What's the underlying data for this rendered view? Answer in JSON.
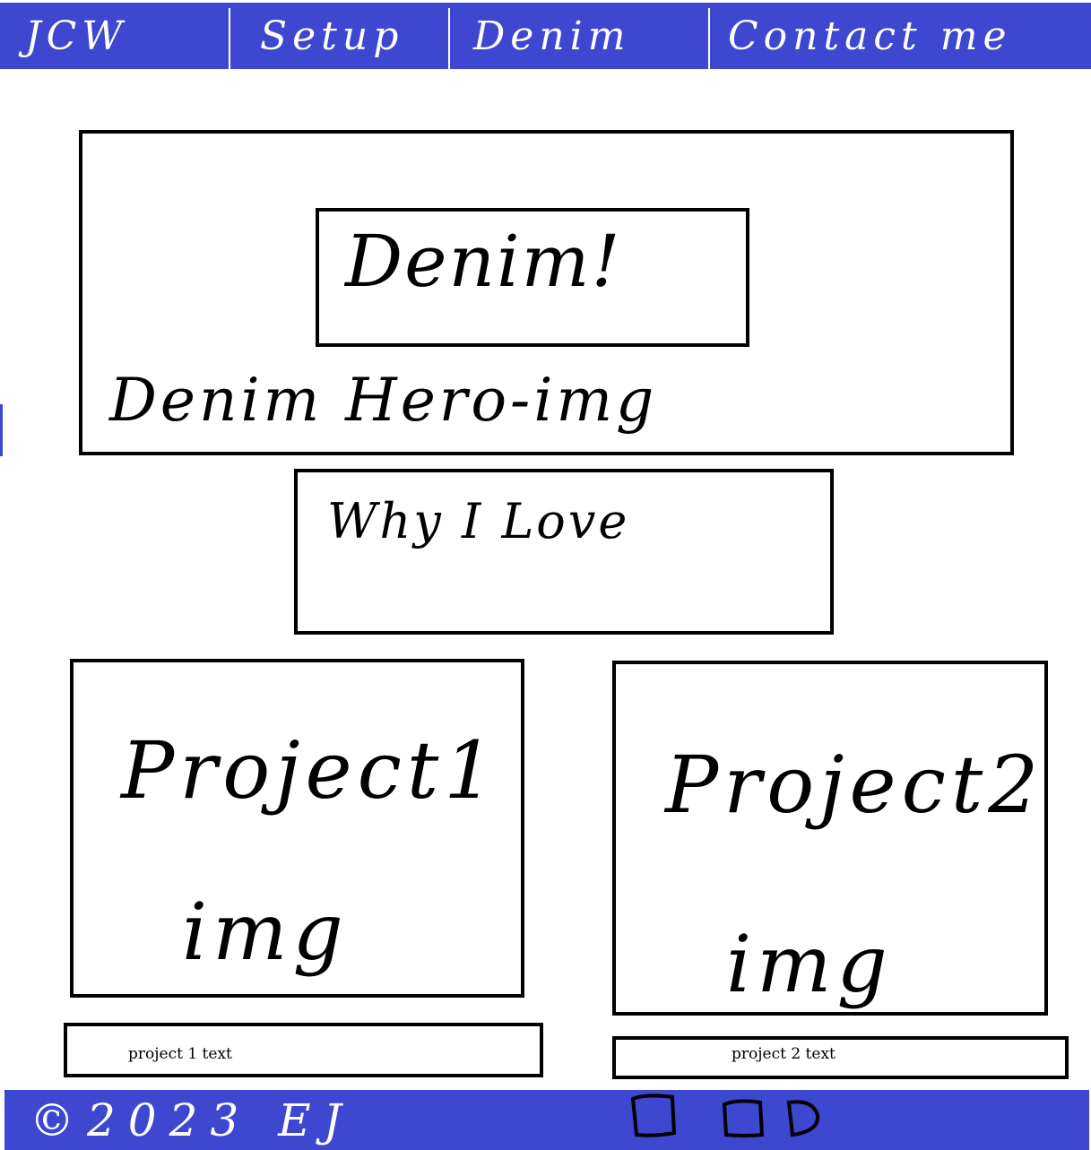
{
  "nav": {
    "brand": "JCW",
    "items": [
      {
        "label": "Setup"
      },
      {
        "label": "Denim"
      },
      {
        "label": "Contact me"
      }
    ]
  },
  "hero": {
    "title": "Denim!",
    "image_label": "Denim Hero-img"
  },
  "why": {
    "text": "Why I Love"
  },
  "projects": [
    {
      "image_label": "Project1\n  img",
      "text": "project 1 text"
    },
    {
      "image_label": "Project2\n  img",
      "text": "project 2 text"
    }
  ],
  "footer": {
    "copyright": "©2023 EJ",
    "social_icons": [
      "social-icon-1",
      "social-icon-2",
      "social-icon-3"
    ],
    "accent_color": "#3d47cf"
  }
}
